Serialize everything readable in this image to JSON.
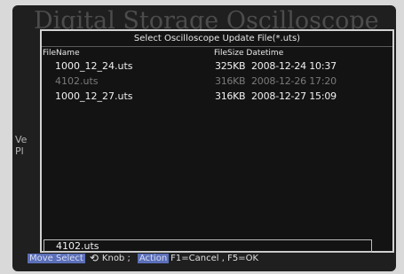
{
  "background": {
    "title": "Digital Storage Oscilloscope",
    "side_text": [
      "Ve",
      "Pl"
    ]
  },
  "dialog": {
    "title": "Select Oscilloscope Update File(*.uts)",
    "columns": {
      "name": "FileName",
      "size_datetime": "FileSize Datetime"
    },
    "files": [
      {
        "name": "1000_12_24.uts",
        "size": "325KB",
        "datetime": "2008-12-24 10:37",
        "dimmed": false
      },
      {
        "name": "4102.uts",
        "size": "316KB",
        "datetime": "2008-12-26 17:20",
        "dimmed": true
      },
      {
        "name": "1000_12_27.uts",
        "size": "316KB",
        "datetime": "2008-12-27 15:09",
        "dimmed": false
      }
    ],
    "selected_file": "4102.uts"
  },
  "help": {
    "move_label": "Move Select",
    "knob_icon": "knob-rotate-icon",
    "knob_label": "Knob ;",
    "action_label": "Action",
    "action_text": "F1=Cancel , F5=OK"
  },
  "colors": {
    "highlight": "#5b6fb8",
    "dialog_bg": "#131313",
    "border": "#d2d2d2"
  }
}
